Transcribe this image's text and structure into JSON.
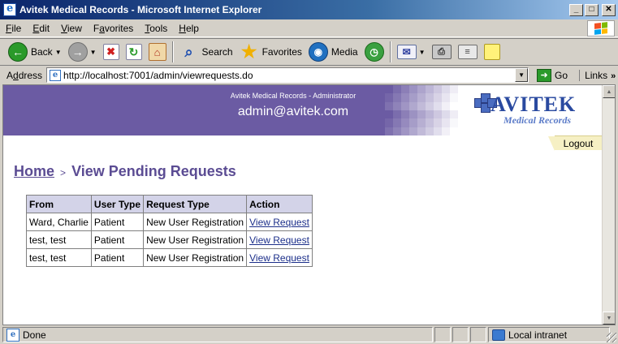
{
  "window": {
    "title": "Avitek Medical Records - Microsoft Internet Explorer",
    "controls": {
      "minimize": "_",
      "maximize": "□",
      "close": "✕"
    }
  },
  "menu": {
    "items": [
      {
        "label": "File",
        "accel": "F",
        "rest": "ile"
      },
      {
        "label": "Edit",
        "accel": "E",
        "rest": "dit"
      },
      {
        "label": "View",
        "accel": "V",
        "rest": "iew"
      },
      {
        "label": "Favorites",
        "accel": "a",
        "pre": "F",
        "rest": "vorites"
      },
      {
        "label": "Tools",
        "accel": "T",
        "rest": "ools"
      },
      {
        "label": "Help",
        "accel": "H",
        "rest": "elp"
      }
    ]
  },
  "toolbar": {
    "back_label": "Back",
    "search_label": "Search",
    "favorites_label": "Favorites",
    "media_label": "Media",
    "icons": [
      "back-arrow-icon",
      "forward-arrow-icon",
      "stop-icon",
      "refresh-icon",
      "home-icon",
      "search-icon",
      "favorites-star-icon",
      "media-icon",
      "history-icon",
      "mail-icon",
      "print-icon",
      "edit-icon",
      "discuss-icon"
    ]
  },
  "address_bar": {
    "label_accel": "d",
    "label_pre": "A",
    "label_rest": "dress",
    "url": "http://localhost:7001/admin/viewrequests.do",
    "go_label": "Go",
    "links_label": "Links",
    "links_more": "»"
  },
  "page": {
    "banner": {
      "subtitle": "Avitek Medical Records - Administrator",
      "user": "admin@avitek.com",
      "logo_text": "AVITEK",
      "logo_subtext": "Medical Records"
    },
    "logout_label": "Logout",
    "breadcrumb": {
      "home": "Home",
      "separator": ">",
      "current": "View Pending Requests"
    },
    "table": {
      "headers": [
        "From",
        "User Type",
        "Request Type",
        "Action"
      ],
      "rows": [
        {
          "from": "Ward, Charlie",
          "user_type": "Patient",
          "request_type": "New User Registration",
          "action": "View Request"
        },
        {
          "from": "test, test",
          "user_type": "Patient",
          "request_type": "New User Registration",
          "action": "View Request"
        },
        {
          "from": "test, test",
          "user_type": "Patient",
          "request_type": "New User Registration",
          "action": "View Request"
        }
      ]
    }
  },
  "status_bar": {
    "status": "Done",
    "zone": "Local intranet"
  },
  "colors": {
    "banner": "#6b5ba3",
    "heading": "#5b4c93",
    "table_header": "#d3d3e8",
    "logout_tab": "#f6f0c4",
    "link": "#1c2f8a"
  }
}
